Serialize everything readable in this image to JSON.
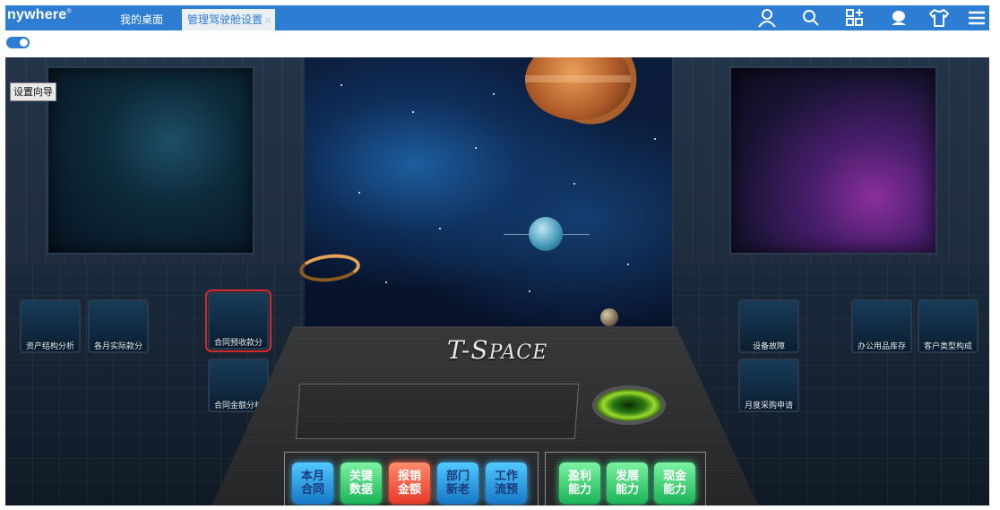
{
  "brand": {
    "name": "nywhere",
    "mark": "®"
  },
  "tabs": [
    {
      "label": "我的桌面"
    },
    {
      "label": "管理驾驶舱设置",
      "close": "×"
    }
  ],
  "toolbar_icons": [
    "user-icon",
    "search-icon",
    "apps-grid-icon",
    "cloud-user-icon",
    "tshirt-icon",
    "menu-icon"
  ],
  "colors": {
    "topbar": "#2d7dd2",
    "highlight": "#d42a2a"
  },
  "settings_button": "设置向导",
  "left_gauges": [
    {
      "label": "资产结构分析"
    },
    {
      "label": "各月实际款分"
    },
    {
      "label": "合同预收款分"
    },
    {
      "label": "合同金额分析"
    }
  ],
  "right_gauges": [
    {
      "label": "设备故障"
    },
    {
      "label": "办公用品库存"
    },
    {
      "label": "客户类型构成"
    },
    {
      "label": "月度采购申请"
    }
  ],
  "console": {
    "title_big": "T-S",
    "title_small": "PACE",
    "buttons_left": [
      {
        "line1": "本月",
        "line2": "合同"
      },
      {
        "line1": "关键",
        "line2": "数据"
      },
      {
        "line1": "报销",
        "line2": "金额"
      },
      {
        "line1": "部门",
        "line2": "新老"
      },
      {
        "line1": "工作",
        "line2": "流预"
      }
    ],
    "buttons_right": [
      {
        "line1": "盈利",
        "line2": "能力"
      },
      {
        "line1": "发展",
        "line2": "能力"
      },
      {
        "line1": "现金",
        "line2": "能力"
      }
    ]
  }
}
